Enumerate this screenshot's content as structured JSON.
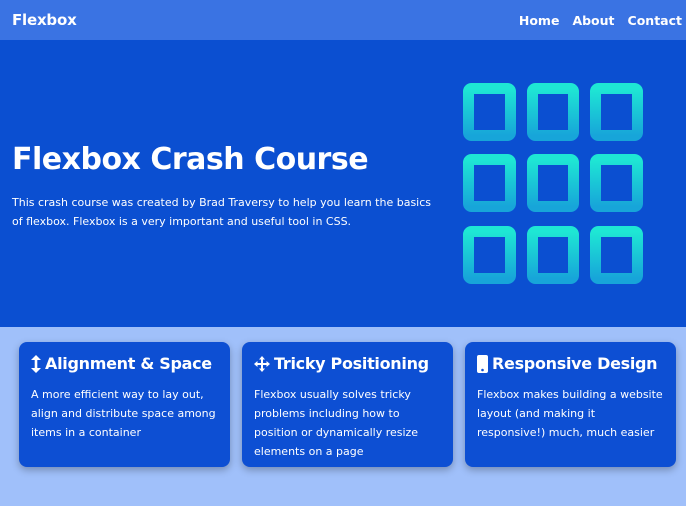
{
  "navbar": {
    "logo": "Flexbox",
    "links": [
      "Home",
      "About",
      "Contact"
    ]
  },
  "hero": {
    "title": "Flexbox Crash Course",
    "text": "This crash course was created by Brad Traversy to help you learn the basics of flexbox. Flexbox is a very important and useful tool in CSS.",
    "icon": "grid-icon",
    "icon_gradient": [
      "#1ee7d4",
      "#17a5d9"
    ]
  },
  "features": [
    {
      "icon": "arrows-vertical-icon",
      "title": "Alignment & Space",
      "text": "A more efficient way to lay out, align and distribute space among items in a container"
    },
    {
      "icon": "arrows-move-icon",
      "title": "Tricky Positioning",
      "text": "Flexbox usually solves tricky problems including how to position or dynamically resize elements on a page"
    },
    {
      "icon": "mobile-icon",
      "title": "Responsive Design",
      "text": "Flexbox makes building a website layout (and making it responsive!) much, much easier"
    }
  ],
  "colors": {
    "navbar": "#3a73e3",
    "hero": "#0b4fd1",
    "card": "#0d4fd3",
    "section_bg": "#a0c0fa"
  }
}
